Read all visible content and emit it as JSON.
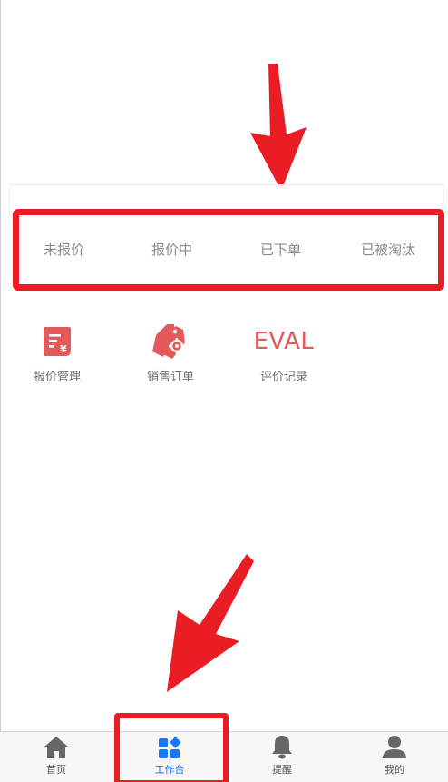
{
  "status_tabs": [
    {
      "label": "未报价"
    },
    {
      "label": "报价中"
    },
    {
      "label": "已下单"
    },
    {
      "label": "已被淘汰"
    }
  ],
  "features": [
    {
      "label": "报价管理",
      "icon": "quote-document-icon"
    },
    {
      "label": "销售订单",
      "icon": "price-tag-gear-icon"
    },
    {
      "label": "评价记录",
      "icon_text": "EVAL"
    }
  ],
  "bottom_nav": [
    {
      "label": "首页",
      "icon": "home-icon"
    },
    {
      "label": "工作台",
      "icon": "grid-icon",
      "active": true
    },
    {
      "label": "提醒",
      "icon": "bell-icon"
    },
    {
      "label": "我的",
      "icon": "user-icon"
    }
  ],
  "colors": {
    "annotation_red": "#ea1c24",
    "feature_red": "#e45a5a",
    "active_blue": "#1677ff",
    "tab_text": "#8a8a8a"
  }
}
